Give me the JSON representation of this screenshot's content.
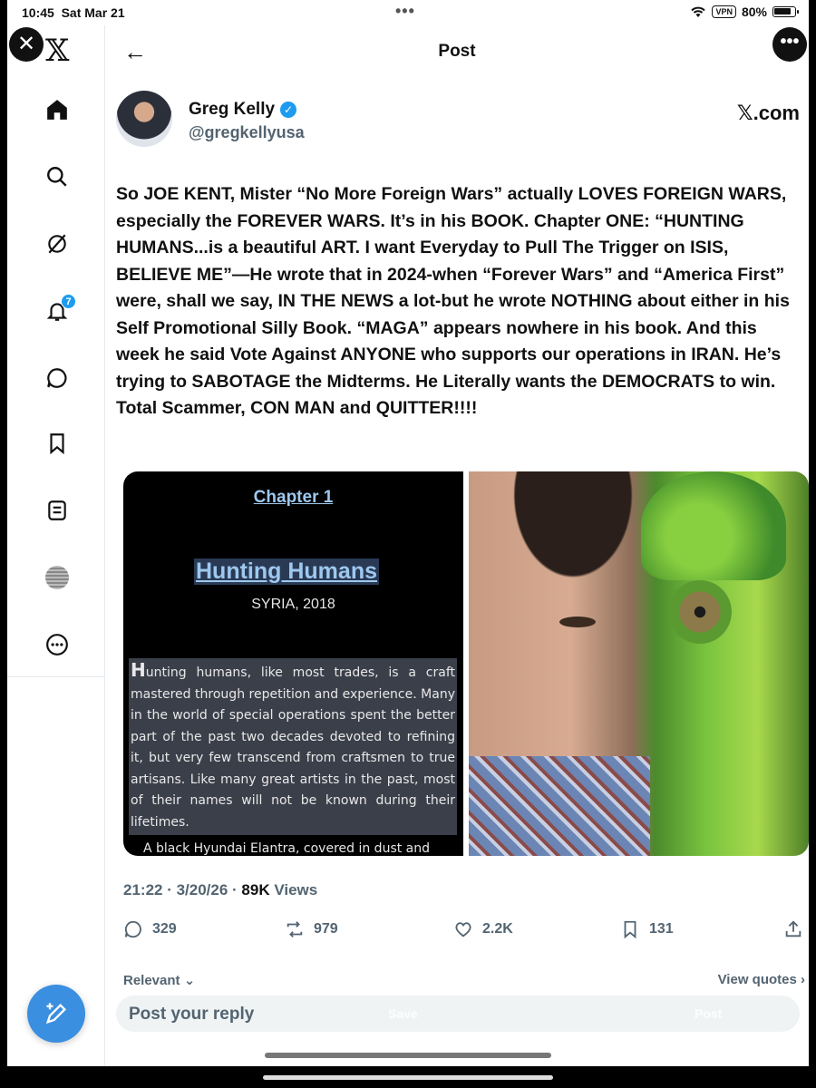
{
  "status_bar": {
    "time": "10:45",
    "date": "Sat Mar 21",
    "vpn": "VPN",
    "battery": "80%"
  },
  "header": {
    "title": "Post"
  },
  "sidebar": {
    "logo": "𝕏",
    "notification_badge": "7",
    "items": [
      "home-icon",
      "search-icon",
      "grok-icon",
      "notifications-icon",
      "messages-icon",
      "bookmarks-icon",
      "lists-icon",
      "profile-avatar",
      "more-icon"
    ]
  },
  "post": {
    "author_name": "Greg Kelly",
    "author_handle": "@gregkellyusa",
    "source": "𝕏.com",
    "text": "So JOE KENT, Mister “No More Foreign Wars” actually LOVES FOREIGN WARS, especially the FOREVER WARS.  It’s in his BOOK.  Chapter ONE: “HUNTING HUMANS...is a beautiful ART.  I want Everyday to Pull The Trigger on ISIS, BELIEVE ME”—He wrote that in 2024-when “Forever Wars” and “America First” were, shall we say, IN THE NEWS a lot-but he wrote NOTHING about either in his Self Promotional Silly Book. “MAGA” appears nowhere in his book. And this week he said Vote Against ANYONE who supports our operations in IRAN.  He’s trying to SABOTAGE the Midterms. He Literally wants the DEMOCRATS to win. Total Scammer, CON MAN and QUITTER!!!!",
    "image_left": {
      "chapter": "Chapter 1",
      "heading": "Hunting Humans",
      "subheading": "SYRIA, 2018",
      "body_dropcap": "H",
      "body": "unting humans, like most trades, is a craft mastered through repetition and experience. Many in the world of special operations spent the better part of the past two decades devoted to refining it, but very few transcend from craftsmen to true artisans. Like many great artists in the past, most of their names will not be known during their lifetimes.",
      "tail": "A black Hyundai Elantra, covered in dust and"
    },
    "timestamp": "21:22 · 3/20/26 · ",
    "views_count": "89K",
    "views_label": " Views",
    "replies": "329",
    "reposts": "979",
    "likes": "2.2K",
    "bookmarks": "131"
  },
  "replies_section": {
    "sort_label": "Relevant ⌄",
    "view_quotes": "View quotes ›",
    "reply_placeholder": "Post your reply",
    "ghost_left": "Save",
    "ghost_right": "Post"
  },
  "colors": {
    "accent": "#1d9bf0",
    "compose_button": "#3b8fe0",
    "secondary_text": "#536471"
  }
}
